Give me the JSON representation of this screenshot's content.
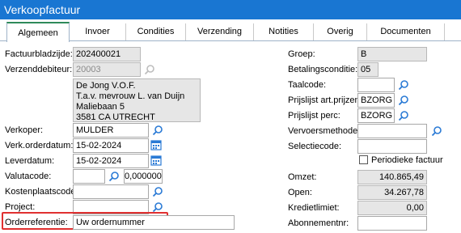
{
  "window": {
    "title": "Verkoopfactuur"
  },
  "tabs": [
    {
      "label": "Algemeen",
      "active": true
    },
    {
      "label": "Invoer"
    },
    {
      "label": "Condities"
    },
    {
      "label": "Verzending"
    },
    {
      "label": "Notities"
    },
    {
      "label": "Overig"
    },
    {
      "label": "Documenten"
    }
  ],
  "left": {
    "factuurbladzijde": {
      "label": "Factuurbladzijde:",
      "value": "202400021"
    },
    "verzenddebiteur": {
      "label": "Verzenddebiteur:",
      "value": "20003"
    },
    "address": [
      "De Jong V.O.F.",
      "T.a.v. mevrouw L. van Duijn",
      "Maliebaan 5",
      "3581 CA UTRECHT"
    ],
    "verkoper": {
      "label": "Verkoper:",
      "value": "MULDER"
    },
    "verk_orderdatum": {
      "label": "Verk.orderdatum:",
      "value": "15-02-2024"
    },
    "leverdatum": {
      "label": "Leverdatum:",
      "value": "15-02-2024"
    },
    "valutacode": {
      "label": "Valutacode:",
      "value": "",
      "rate": "0,000000"
    },
    "kostenplaatscode": {
      "label": "Kostenplaatscode:",
      "value": ""
    },
    "project": {
      "label": "Project:",
      "value": ""
    },
    "orderreferentie": {
      "label": "Orderreferentie:",
      "value": "Uw ordernummer"
    }
  },
  "right": {
    "groep": {
      "label": "Groep:",
      "value": "B"
    },
    "betalingsconditie": {
      "label": "Betalingsconditie:",
      "value": "05"
    },
    "taalcode": {
      "label": "Taalcode:",
      "value": ""
    },
    "prijslijst_art": {
      "label": "Prijslijst art.prijzen:",
      "value": "BZORG"
    },
    "prijslijst_perc": {
      "label": "Prijslijst perc:",
      "value": "BZORG"
    },
    "vervoersmethode": {
      "label": "Vervoersmethode:",
      "value": ""
    },
    "selectiecode": {
      "label": "Selectiecode:",
      "value": ""
    },
    "periodieke": {
      "label": "Periodieke factuur",
      "checked": false
    },
    "omzet": {
      "label": "Omzet:",
      "value": "140.865,49"
    },
    "open": {
      "label": "Open:",
      "value": "34.267,78"
    },
    "kredietlimiet": {
      "label": "Kredietlimiet:",
      "value": "0,00"
    },
    "abonnementnr": {
      "label": "Abonnementnr:",
      "value": ""
    }
  },
  "colors": {
    "titlebar": "#1976d2",
    "highlight": "#e03030",
    "icon": "#2a7ad5"
  }
}
